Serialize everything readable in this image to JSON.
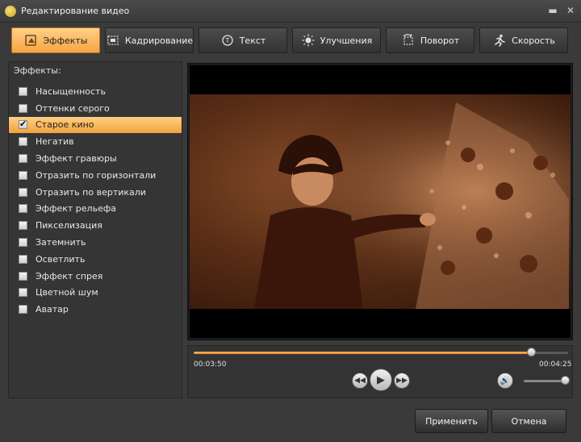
{
  "window": {
    "title": "Редактирование видео",
    "minimize_icon": "minimize-icon",
    "close_icon": "close-icon"
  },
  "tabs": [
    {
      "label": "Эффекты",
      "icon": "effects-icon",
      "active": true
    },
    {
      "label": "Кадрирование",
      "icon": "crop-icon",
      "active": false
    },
    {
      "label": "Текст",
      "icon": "text-icon",
      "active": false
    },
    {
      "label": "Улучшения",
      "icon": "brightness-icon",
      "active": false
    },
    {
      "label": "Поворот",
      "icon": "rotate-icon",
      "active": false
    },
    {
      "label": "Скорость",
      "icon": "speed-icon",
      "active": false
    }
  ],
  "effects_panel": {
    "label": "Эффекты:",
    "items": [
      {
        "label": "Насыщенность",
        "checked": false
      },
      {
        "label": "Оттенки серого",
        "checked": false
      },
      {
        "label": "Старое кино",
        "checked": true
      },
      {
        "label": "Негатив",
        "checked": false
      },
      {
        "label": "Эффект гравюры",
        "checked": false
      },
      {
        "label": "Отразить по горизонтали",
        "checked": false
      },
      {
        "label": "Отразить по вертикали",
        "checked": false
      },
      {
        "label": "Эффект рельефа",
        "checked": false
      },
      {
        "label": "Пикселизация",
        "checked": false
      },
      {
        "label": "Затемнить",
        "checked": false
      },
      {
        "label": "Осветлить",
        "checked": false
      },
      {
        "label": "Эффект спрея",
        "checked": false
      },
      {
        "label": "Цветной шум",
        "checked": false
      },
      {
        "label": "Аватар",
        "checked": false
      }
    ]
  },
  "player": {
    "current_time": "00:03:50",
    "total_time": "00:04:25",
    "progress": 0.9,
    "volume": 0.95
  },
  "buttons": {
    "apply": "Применить",
    "cancel": "Отмена"
  },
  "colors": {
    "accent": "#f6a440",
    "background": "#3a3a3a"
  }
}
